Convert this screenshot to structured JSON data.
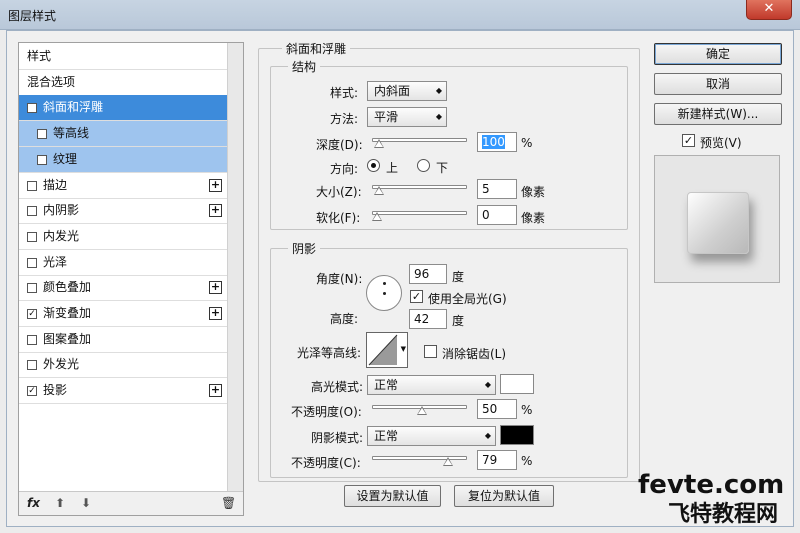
{
  "window": {
    "title": "图层样式",
    "close": "✕"
  },
  "stylelist": {
    "items": [
      {
        "label": "样式",
        "checked": false,
        "has_checkbox": false,
        "plus": false
      },
      {
        "label": "混合选项",
        "checked": false,
        "has_checkbox": false,
        "plus": false
      },
      {
        "label": "斜面和浮雕",
        "checked": true,
        "has_checkbox": true,
        "plus": false,
        "selected": true
      },
      {
        "label": "等高线",
        "checked": false,
        "has_checkbox": true,
        "plus": false,
        "sub": true
      },
      {
        "label": "纹理",
        "checked": false,
        "has_checkbox": true,
        "plus": false,
        "sub": true
      },
      {
        "label": "描边",
        "checked": false,
        "has_checkbox": true,
        "plus": true
      },
      {
        "label": "内阴影",
        "checked": false,
        "has_checkbox": true,
        "plus": true
      },
      {
        "label": "内发光",
        "checked": false,
        "has_checkbox": true,
        "plus": false
      },
      {
        "label": "光泽",
        "checked": false,
        "has_checkbox": true,
        "plus": false
      },
      {
        "label": "颜色叠加",
        "checked": false,
        "has_checkbox": true,
        "plus": true
      },
      {
        "label": "渐变叠加",
        "checked": true,
        "has_checkbox": true,
        "plus": true
      },
      {
        "label": "图案叠加",
        "checked": false,
        "has_checkbox": true,
        "plus": false
      },
      {
        "label": "外发光",
        "checked": false,
        "has_checkbox": true,
        "plus": false
      },
      {
        "label": "投影",
        "checked": true,
        "has_checkbox": true,
        "plus": true
      }
    ],
    "footer": {
      "fx": "fx",
      "up": "⬆",
      "down": "⬇",
      "trash": "🗑"
    }
  },
  "bevel": {
    "title": "斜面和浮雕",
    "structure": {
      "title": "结构",
      "style_label": "样式:",
      "style_value": "内斜面",
      "method_label": "方法:",
      "method_value": "平滑",
      "depth_label": "深度(D):",
      "depth_value": "100",
      "depth_unit": "%",
      "depth_level": 0.02,
      "direction_label": "方向:",
      "dir_up": "上",
      "dir_down": "下",
      "size_label": "大小(Z):",
      "size_value": "5",
      "size_unit": "像素",
      "size_level": 0.02,
      "soften_label": "软化(F):",
      "soften_value": "0",
      "soften_unit": "像素",
      "soften_level": 0.0
    },
    "shading": {
      "title": "阴影",
      "angle_label": "角度(N):",
      "angle_value": "96",
      "angle_unit": "度",
      "global_light_label": "使用全局光(G)",
      "altitude_label": "高度:",
      "altitude_value": "42",
      "altitude_unit": "度",
      "gloss_label": "光泽等高线:",
      "antialias_label": "消除锯齿(L)",
      "highlight_label": "高光模式:",
      "highlight_value": "正常",
      "highlight_color": "#ffffff",
      "hl_opacity_label": "不透明度(O):",
      "hl_opacity_value": "50",
      "hl_opacity_unit": "%",
      "hl_opacity_level": 0.5,
      "shadow_label": "阴影模式:",
      "shadow_value": "正常",
      "shadow_color": "#000000",
      "sh_opacity_label": "不透明度(C):",
      "sh_opacity_value": "79",
      "sh_opacity_unit": "%",
      "sh_opacity_level": 0.79
    },
    "make_default": "设置为默认值",
    "reset_default": "复位为默认值"
  },
  "buttons": {
    "ok": "确定",
    "cancel": "取消",
    "new_style": "新建样式(W)...",
    "preview": "预览(V)"
  },
  "watermark": {
    "line1": "fevte.com",
    "line2": "飞特教程网"
  }
}
